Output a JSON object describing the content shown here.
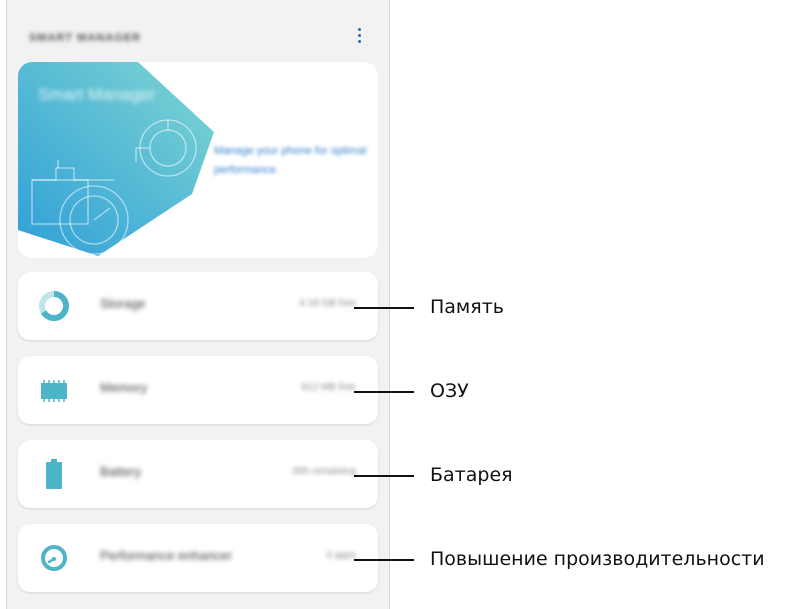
{
  "app": {
    "title": "SMART MANAGER"
  },
  "hero": {
    "title": "Smart Manager",
    "description": "Manage your phone for optimal performance."
  },
  "items": [
    {
      "label": "Storage",
      "value": "4.18 GB free",
      "icon": "storage-ring-icon"
    },
    {
      "label": "Memory",
      "value": "912 MB free",
      "icon": "memory-chip-icon"
    },
    {
      "label": "Battery",
      "value": "00h remaining",
      "icon": "battery-icon"
    },
    {
      "label": "Performance enhancer",
      "value": "3 apps",
      "icon": "gauge-icon"
    }
  ],
  "callouts": [
    {
      "text": "Память"
    },
    {
      "text": "ОЗУ"
    },
    {
      "text": "Батарея"
    },
    {
      "text": "Повышение производительности"
    }
  ],
  "colors": {
    "accent": "#2d6fb8",
    "teal": "#4eb4c8",
    "hero_gradient_start": "#2f9fd8",
    "hero_gradient_end": "#75d0d0"
  }
}
